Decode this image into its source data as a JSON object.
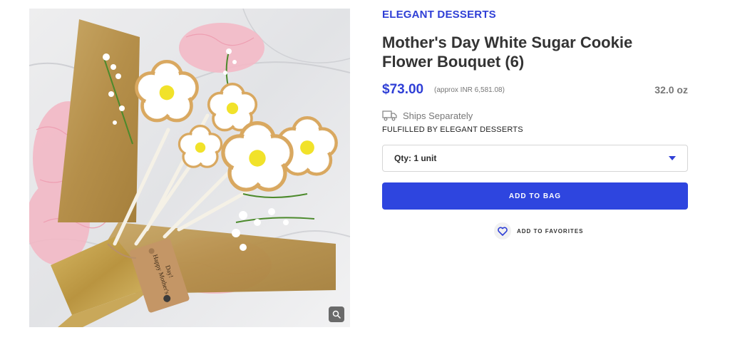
{
  "product": {
    "brand": "ELEGANT DESSERTS",
    "title": "Mother's Day White Sugar Cookie Flower Bouquet (6)",
    "price": "$73.00",
    "approx_price": "(approx INR 6,581.08)",
    "weight": "32.0 oz",
    "shipping_note": "Ships Separately",
    "fulfilled_by": "FULFILLED BY ELEGANT DESSERTS"
  },
  "quantity": {
    "selected": "Qty: 1 unit"
  },
  "actions": {
    "add_to_bag": "ADD TO BAG",
    "add_to_favorites": "ADD TO FAVORITES"
  },
  "image": {
    "tag_text": "Happy Mother's Day!"
  },
  "icons": {
    "truck": "truck-icon",
    "heart": "heart-icon",
    "zoom": "zoom-icon",
    "caret": "chevron-down-icon"
  },
  "colors": {
    "accent": "#2f3fd6",
    "button": "#2e45df",
    "muted": "#777777"
  }
}
